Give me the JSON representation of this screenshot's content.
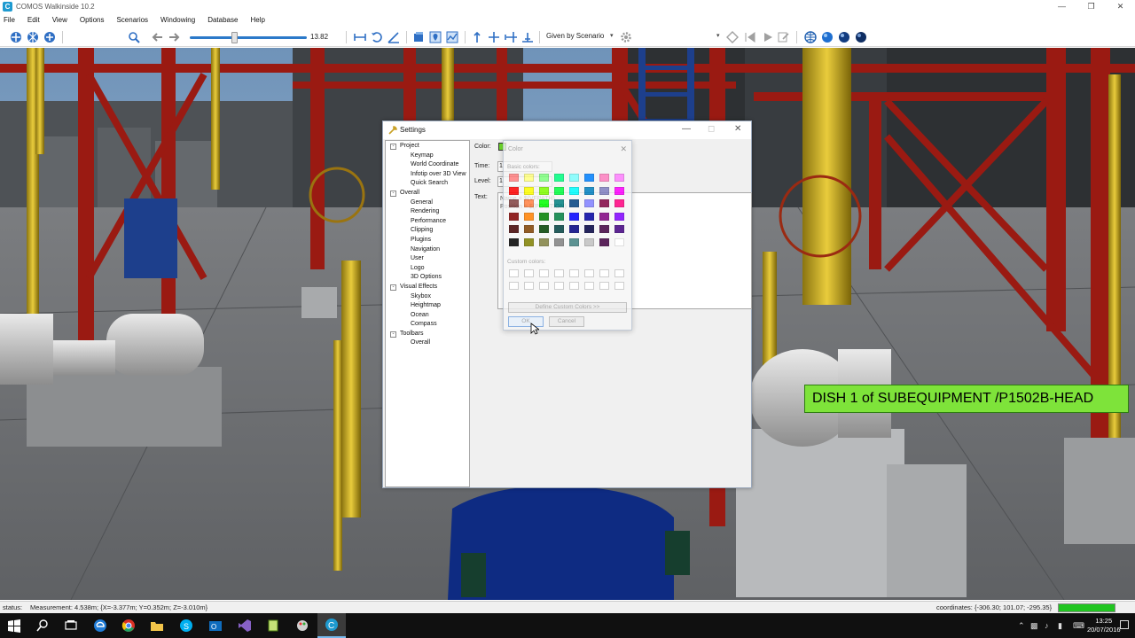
{
  "window": {
    "title": "COMOS Walkinside 10.2",
    "icon_letter": "C"
  },
  "menu": [
    "File",
    "Edit",
    "View",
    "Options",
    "Scenarios",
    "Windowing",
    "Database",
    "Help"
  ],
  "toolbar": {
    "speed_value": "13.82",
    "speed_level": 0.38,
    "scenario_select": "Given by Scenario"
  },
  "label_overlay": "DISH 1 of SUBEQUIPMENT /P1502B-HEAD",
  "settings": {
    "title": "Settings",
    "tree": [
      {
        "label": "Project",
        "level": 0,
        "expander": "-"
      },
      {
        "label": "Keymap",
        "level": 1
      },
      {
        "label": "World Coordinate",
        "level": 1
      },
      {
        "label": "Infotip over 3D View",
        "level": 1
      },
      {
        "label": "Quick Search",
        "level": 1
      },
      {
        "label": "Overall",
        "level": 0,
        "expander": "-"
      },
      {
        "label": "General",
        "level": 1
      },
      {
        "label": "Rendering",
        "level": 1
      },
      {
        "label": "Performance",
        "level": 1
      },
      {
        "label": "Clipping",
        "level": 1
      },
      {
        "label": "Plugins",
        "level": 1
      },
      {
        "label": "Navigation",
        "level": 1
      },
      {
        "label": "User",
        "level": 1
      },
      {
        "label": "Logo",
        "level": 1
      },
      {
        "label": "3D Options",
        "level": 1
      },
      {
        "label": "Visual Effects",
        "level": 0,
        "expander": "-"
      },
      {
        "label": "Skybox",
        "level": 1
      },
      {
        "label": "Heightmap",
        "level": 1
      },
      {
        "label": "Ocean",
        "level": 1
      },
      {
        "label": "Compass",
        "level": 1
      },
      {
        "label": "Toolbars",
        "level": 0,
        "expander": "-"
      },
      {
        "label": "Overall",
        "level": 1
      }
    ],
    "color_label": "Color:",
    "color_value": "#6fdc2a",
    "time_label": "Time:",
    "time_value": "1",
    "level_label": "Level:",
    "level_value": "1",
    "text_label": "Text:",
    "text_value_line1": "Name = $(VFPATH)",
    "text_value_line2": "Position = $(POSITION)"
  },
  "color_dialog": {
    "title": "Color",
    "basic_colors_label": "Basic colors:",
    "custom_colors_label": "Custom colors:",
    "define_custom_label": "Define Custom Colors >>",
    "ok_label": "OK",
    "cancel_label": "Cancel",
    "basic_colors": [
      "#ff8080",
      "#ffff80",
      "#80ff80",
      "#00ff80",
      "#80ffff",
      "#0080ff",
      "#ff80c0",
      "#ff80ff",
      "#ff0000",
      "#ffff00",
      "#80ff00",
      "#00ff40",
      "#00ffff",
      "#0080c0",
      "#8080c0",
      "#ff00ff",
      "#804040",
      "#ff8040",
      "#00ff00",
      "#008080",
      "#004080",
      "#8080ff",
      "#800040",
      "#ff0080",
      "#800000",
      "#ff8000",
      "#008000",
      "#008040",
      "#0000ff",
      "#0000a0",
      "#800080",
      "#8000ff",
      "#400000",
      "#804000",
      "#004000",
      "#004040",
      "#000080",
      "#000040",
      "#400040",
      "#400080",
      "#000000",
      "#808000",
      "#808040",
      "#808080",
      "#408080",
      "#c0c0c0",
      "#400040",
      "#ffffff"
    ]
  },
  "status": {
    "label": "status:",
    "measurement": "Measurement: 4.538m; {X=-3.377m; Y=0.352m; Z=-3.010m}",
    "coordinates": "coordinates: {-306.30; 101.07; -295.35}"
  },
  "taskbar": {
    "time": "13:25",
    "date": "20/07/2016"
  }
}
